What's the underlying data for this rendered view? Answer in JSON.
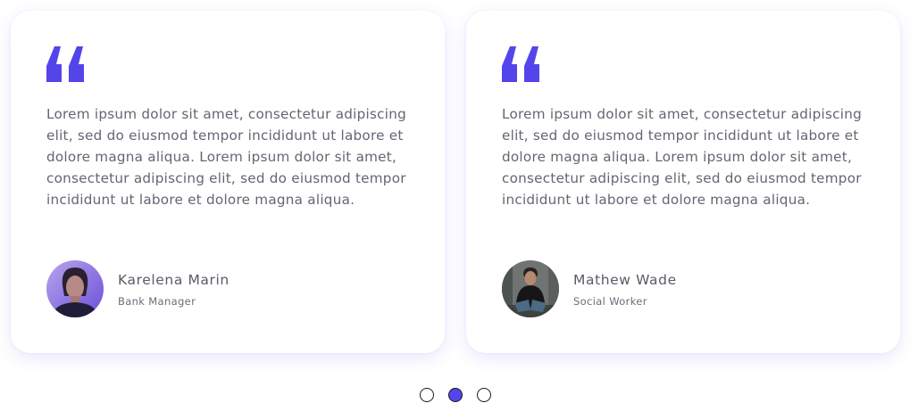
{
  "accent_color": "#5445ea",
  "testimonials": [
    {
      "quote": "Lorem ipsum dolor sit amet, consectetur adipiscing elit, sed do eiusmod tempor incididunt ut labore et dolore magna aliqua. Lorem ipsum dolor sit amet, consectetur adipiscing elit, sed do eiusmod tempor incididunt ut labore et dolore magna aliqua.",
      "name": "Karelena Marin",
      "role": "Bank Manager",
      "avatar_icon": "woman-portrait-avatar"
    },
    {
      "quote": "Lorem ipsum dolor sit amet, consectetur adipiscing elit, sed do eiusmod tempor incididunt ut labore et dolore magna aliqua. Lorem ipsum dolor sit amet, consectetur adipiscing elit, sed do eiusmod tempor incididunt ut labore et dolore magna aliqua.",
      "name": "Mathew Wade",
      "role": "Social Worker",
      "avatar_icon": "man-portrait-avatar"
    }
  ],
  "pagination": {
    "count": 3,
    "active_index": 1
  }
}
